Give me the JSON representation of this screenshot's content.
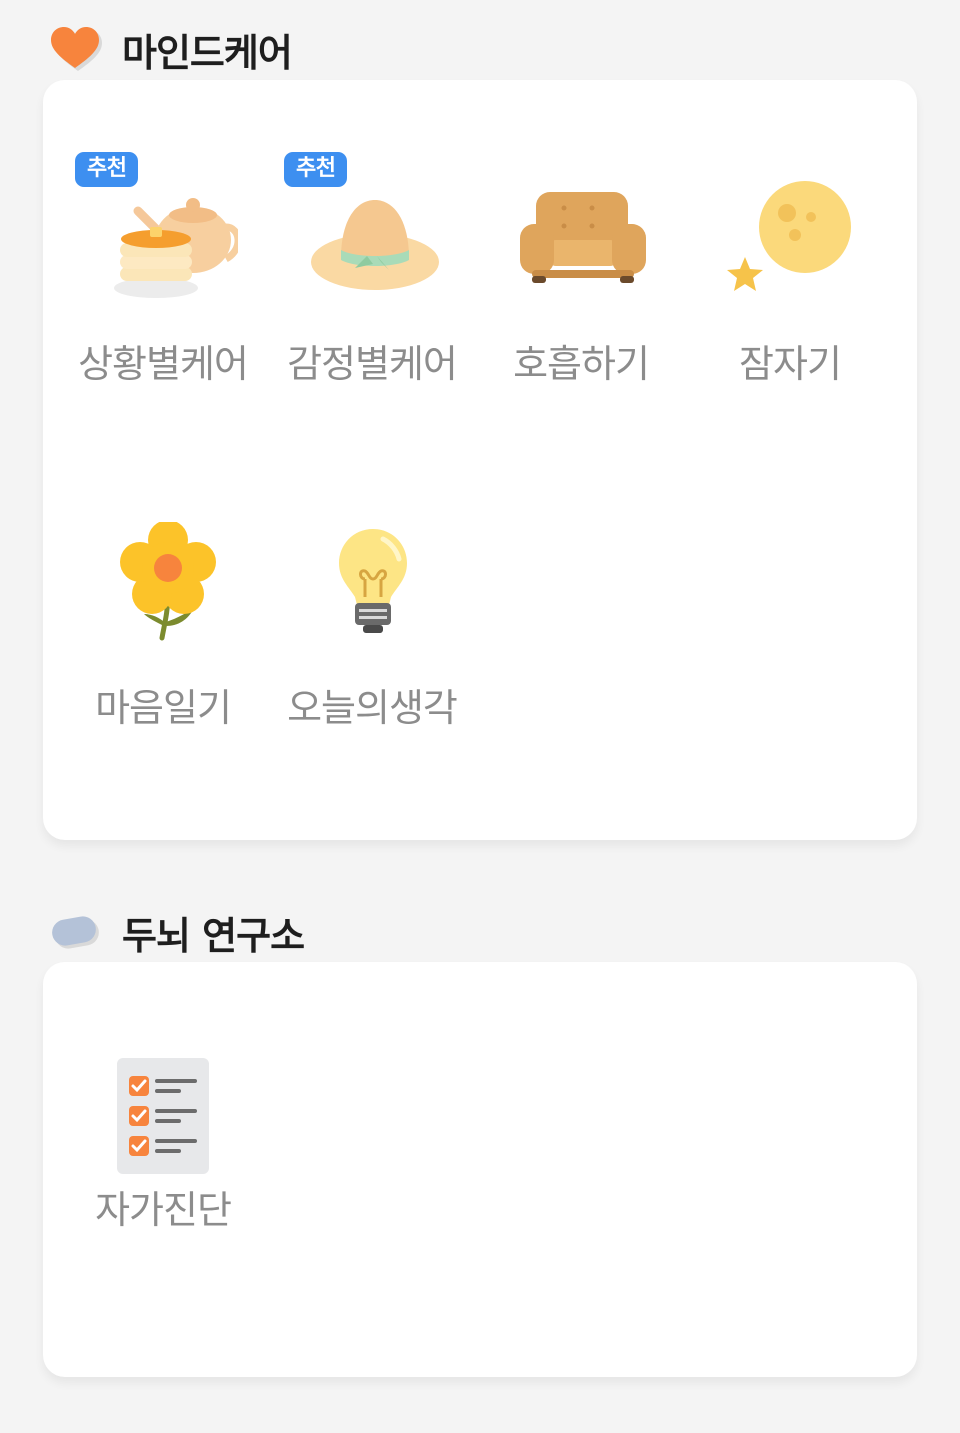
{
  "sections": [
    {
      "title": "마인드케어",
      "icon": "heart-icon",
      "accent": "#f7843d",
      "badge_color": "#3d8ff0",
      "items": [
        {
          "label": "상황별케어",
          "icon": "pancake-teapot-icon",
          "badge": "추천"
        },
        {
          "label": "감정별케어",
          "icon": "hat-icon",
          "badge": "추천"
        },
        {
          "label": "호흡하기",
          "icon": "armchair-icon"
        },
        {
          "label": "잠자기",
          "icon": "moon-star-icon"
        },
        {
          "label": "마음일기",
          "icon": "flower-icon"
        },
        {
          "label": "오늘의생각",
          "icon": "lightbulb-icon"
        }
      ]
    },
    {
      "title": "두뇌 연구소",
      "icon": "brain-pill-icon",
      "items": [
        {
          "label": "자가진단",
          "icon": "checklist-icon"
        }
      ]
    }
  ]
}
